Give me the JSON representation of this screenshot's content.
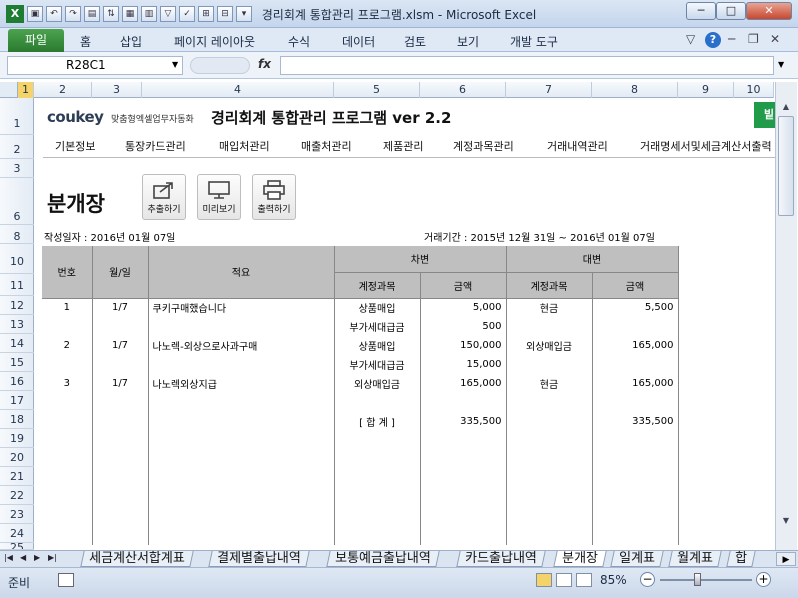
{
  "window": {
    "title": "경리회계 통합관리 프로그램.xlsm  -  Microsoft Excel"
  },
  "ribbon": {
    "file_tab": "파일",
    "tabs": [
      "홈",
      "삽입",
      "페이지 레이아웃",
      "수식",
      "데이터",
      "검토",
      "보기",
      "개발 도구"
    ]
  },
  "formula_bar": {
    "name_box": "R28C1",
    "fx_label": "fx",
    "formula": ""
  },
  "columns": [
    "1",
    "2",
    "3",
    "4",
    "5",
    "6",
    "7",
    "8",
    "9",
    "10"
  ],
  "rows": [
    "1",
    "2",
    "3",
    "6",
    "8",
    "10",
    "11",
    "12",
    "13",
    "14",
    "15",
    "16",
    "17",
    "18",
    "19",
    "20",
    "21",
    "22",
    "23",
    "24",
    "25"
  ],
  "sheet": {
    "logo": "coukey",
    "logo_sub": "맞춤형엑셀업무자동화",
    "app_title": "경리회계 통합관리 프로그램 ver 2.2",
    "green_box": "빝",
    "menu": [
      "기본정보",
      "통장카드관리",
      "매입처관리",
      "매출처관리",
      "제품관리",
      "계정과목관리",
      "거래내역관리",
      "거래명세서및세금계산서출력"
    ],
    "page_title": "분개장",
    "buttons": {
      "export": "추출하기",
      "preview": "미리보기",
      "print": "출력하기"
    },
    "created_date": "작성일자 : 2016년 01월 07일",
    "period": "거래기간 : 2015년 12월 31일 ~ 2016년 01월 07일",
    "headers": {
      "no": "번호",
      "date": "월/일",
      "memo": "적요",
      "debit": "차변",
      "credit": "대변",
      "debit_account": "계정과목",
      "debit_amount": "금액",
      "credit_account": "계정과목",
      "credit_amount": "금액"
    },
    "entries": [
      {
        "no": "1",
        "date": "1/7",
        "memo": "쿠키구매했습니다",
        "debit_account": "상품매입",
        "debit_amount": "5,000",
        "credit_account": "현금",
        "credit_amount": "5,500"
      },
      {
        "no": "",
        "date": "",
        "memo": "",
        "debit_account": "부가세대급금",
        "debit_amount": "500",
        "credit_account": "",
        "credit_amount": ""
      },
      {
        "no": "2",
        "date": "1/7",
        "memo": "나노렉-외상으로사과구매",
        "debit_account": "상품매입",
        "debit_amount": "150,000",
        "credit_account": "외상매입금",
        "credit_amount": "165,000"
      },
      {
        "no": "",
        "date": "",
        "memo": "",
        "debit_account": "부가세대급금",
        "debit_amount": "15,000",
        "credit_account": "",
        "credit_amount": ""
      },
      {
        "no": "3",
        "date": "1/7",
        "memo": "나노렉외상지급",
        "debit_account": "외상매입금",
        "debit_amount": "165,000",
        "credit_account": "현금",
        "credit_amount": "165,000"
      },
      {
        "no": "",
        "date": "",
        "memo": "",
        "debit_account": "",
        "debit_amount": "",
        "credit_account": "",
        "credit_amount": ""
      },
      {
        "no": "",
        "date": "",
        "memo": "",
        "debit_account": "[ 합     계 ]",
        "debit_amount": "335,500",
        "credit_account": "",
        "credit_amount": "335,500"
      },
      {
        "no": "",
        "date": "",
        "memo": "",
        "debit_account": "",
        "debit_amount": "",
        "credit_account": "",
        "credit_amount": ""
      },
      {
        "no": "",
        "date": "",
        "memo": "",
        "debit_account": "",
        "debit_amount": "",
        "credit_account": "",
        "credit_amount": ""
      },
      {
        "no": "",
        "date": "",
        "memo": "",
        "debit_account": "",
        "debit_amount": "",
        "credit_account": "",
        "credit_amount": ""
      },
      {
        "no": "",
        "date": "",
        "memo": "",
        "debit_account": "",
        "debit_amount": "",
        "credit_account": "",
        "credit_amount": ""
      },
      {
        "no": "",
        "date": "",
        "memo": "",
        "debit_account": "",
        "debit_amount": "",
        "credit_account": "",
        "credit_amount": ""
      },
      {
        "no": "",
        "date": "",
        "memo": "",
        "debit_account": "",
        "debit_amount": "",
        "credit_account": "",
        "credit_amount": ""
      }
    ]
  },
  "sheet_tabs": [
    "세금계산서합계표",
    "결제별출납내역",
    "보통예금출납내역",
    "카드출납내역",
    "분개장",
    "일계표",
    "월계표",
    "합"
  ],
  "active_sheet_tab": "분개장",
  "status": {
    "ready": "준비",
    "zoom": "85%"
  },
  "colors": {
    "excel_green": "#1e7d33",
    "table_header": "#bfbfbf",
    "ribbon_bg": "#dfe9f5"
  }
}
